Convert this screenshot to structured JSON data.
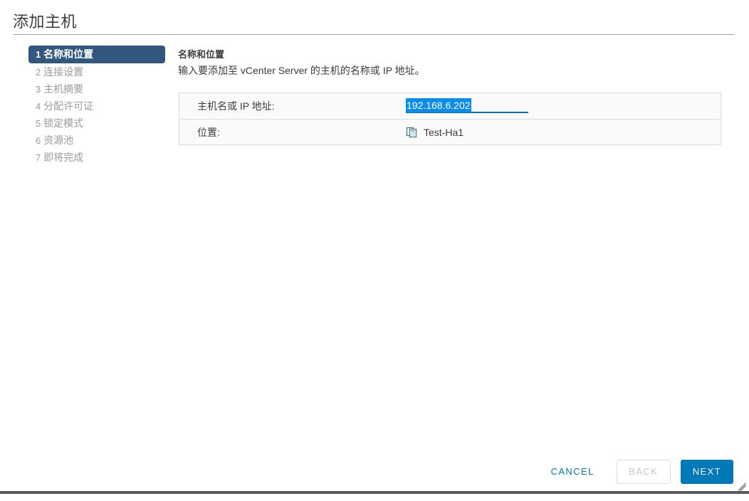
{
  "window": {
    "title": "添加主机"
  },
  "steps": [
    {
      "num": "1",
      "label": "名称和位置",
      "active": true
    },
    {
      "num": "2",
      "label": "连接设置",
      "active": false
    },
    {
      "num": "3",
      "label": "主机摘要",
      "active": false
    },
    {
      "num": "4",
      "label": "分配许可证",
      "active": false
    },
    {
      "num": "5",
      "label": "锁定模式",
      "active": false
    },
    {
      "num": "6",
      "label": "资源池",
      "active": false
    },
    {
      "num": "7",
      "label": "即将完成",
      "active": false
    }
  ],
  "content": {
    "title": "名称和位置",
    "subtitle": "输入要添加至 vCenter Server 的主机的名称或 IP 地址。"
  },
  "form": {
    "host": {
      "label": "主机名或 IP 地址:",
      "value": "192.168.6.202",
      "placeholder": "",
      "selected": true
    },
    "location": {
      "label": "位置:",
      "value": "Test-Ha1",
      "icon": "datacenter-icon"
    }
  },
  "footer": {
    "cancel_label": "CANCEL",
    "back_label": "BACK",
    "next_label": "NEXT",
    "back_disabled": true
  },
  "colors": {
    "accent": "#0079b8",
    "active_step_bg": "#31577e",
    "selection_bg": "#0b8ce8",
    "panel_border": "#dcdcdc",
    "panel_bg": "#fafafa",
    "muted_text": "#9a9a9a",
    "bottom_bar": "#5a5a5a"
  }
}
